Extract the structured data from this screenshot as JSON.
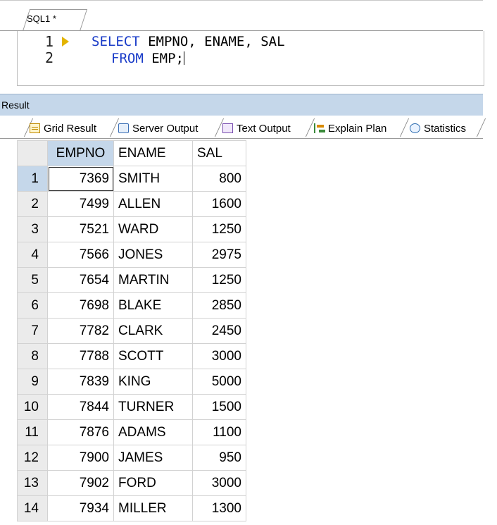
{
  "editor": {
    "tab_label": "SQL1 *",
    "line_numbers": [
      "1",
      "2"
    ],
    "line1": {
      "keyword": "SELECT",
      "rest": " EMPNO, ENAME, SAL"
    },
    "line2": {
      "keyword": "FROM",
      "rest": " EMP;"
    }
  },
  "result": {
    "title": "Result",
    "tabs": [
      {
        "label": "Grid Result",
        "icon": "grid-icon"
      },
      {
        "label": "Server Output",
        "icon": "server-output-icon"
      },
      {
        "label": "Text Output",
        "icon": "text-output-icon"
      },
      {
        "label": "Explain Plan",
        "icon": "explain-plan-icon"
      },
      {
        "label": "Statistics",
        "icon": "statistics-icon"
      }
    ]
  },
  "grid": {
    "columns": [
      "EMPNO",
      "ENAME",
      "SAL"
    ],
    "rows": [
      {
        "n": "1",
        "empno": "7369",
        "ename": "SMITH",
        "sal": "800"
      },
      {
        "n": "2",
        "empno": "7499",
        "ename": "ALLEN",
        "sal": "1600"
      },
      {
        "n": "3",
        "empno": "7521",
        "ename": "WARD",
        "sal": "1250"
      },
      {
        "n": "4",
        "empno": "7566",
        "ename": "JONES",
        "sal": "2975"
      },
      {
        "n": "5",
        "empno": "7654",
        "ename": "MARTIN",
        "sal": "1250"
      },
      {
        "n": "6",
        "empno": "7698",
        "ename": "BLAKE",
        "sal": "2850"
      },
      {
        "n": "7",
        "empno": "7782",
        "ename": "CLARK",
        "sal": "2450"
      },
      {
        "n": "8",
        "empno": "7788",
        "ename": "SCOTT",
        "sal": "3000"
      },
      {
        "n": "9",
        "empno": "7839",
        "ename": "KING",
        "sal": "5000"
      },
      {
        "n": "10",
        "empno": "7844",
        "ename": "TURNER",
        "sal": "1500"
      },
      {
        "n": "11",
        "empno": "7876",
        "ename": "ADAMS",
        "sal": "1100"
      },
      {
        "n": "12",
        "empno": "7900",
        "ename": "JAMES",
        "sal": "950"
      },
      {
        "n": "13",
        "empno": "7902",
        "ename": "FORD",
        "sal": "3000"
      },
      {
        "n": "14",
        "empno": "7934",
        "ename": "MILLER",
        "sal": "1300"
      }
    ]
  }
}
